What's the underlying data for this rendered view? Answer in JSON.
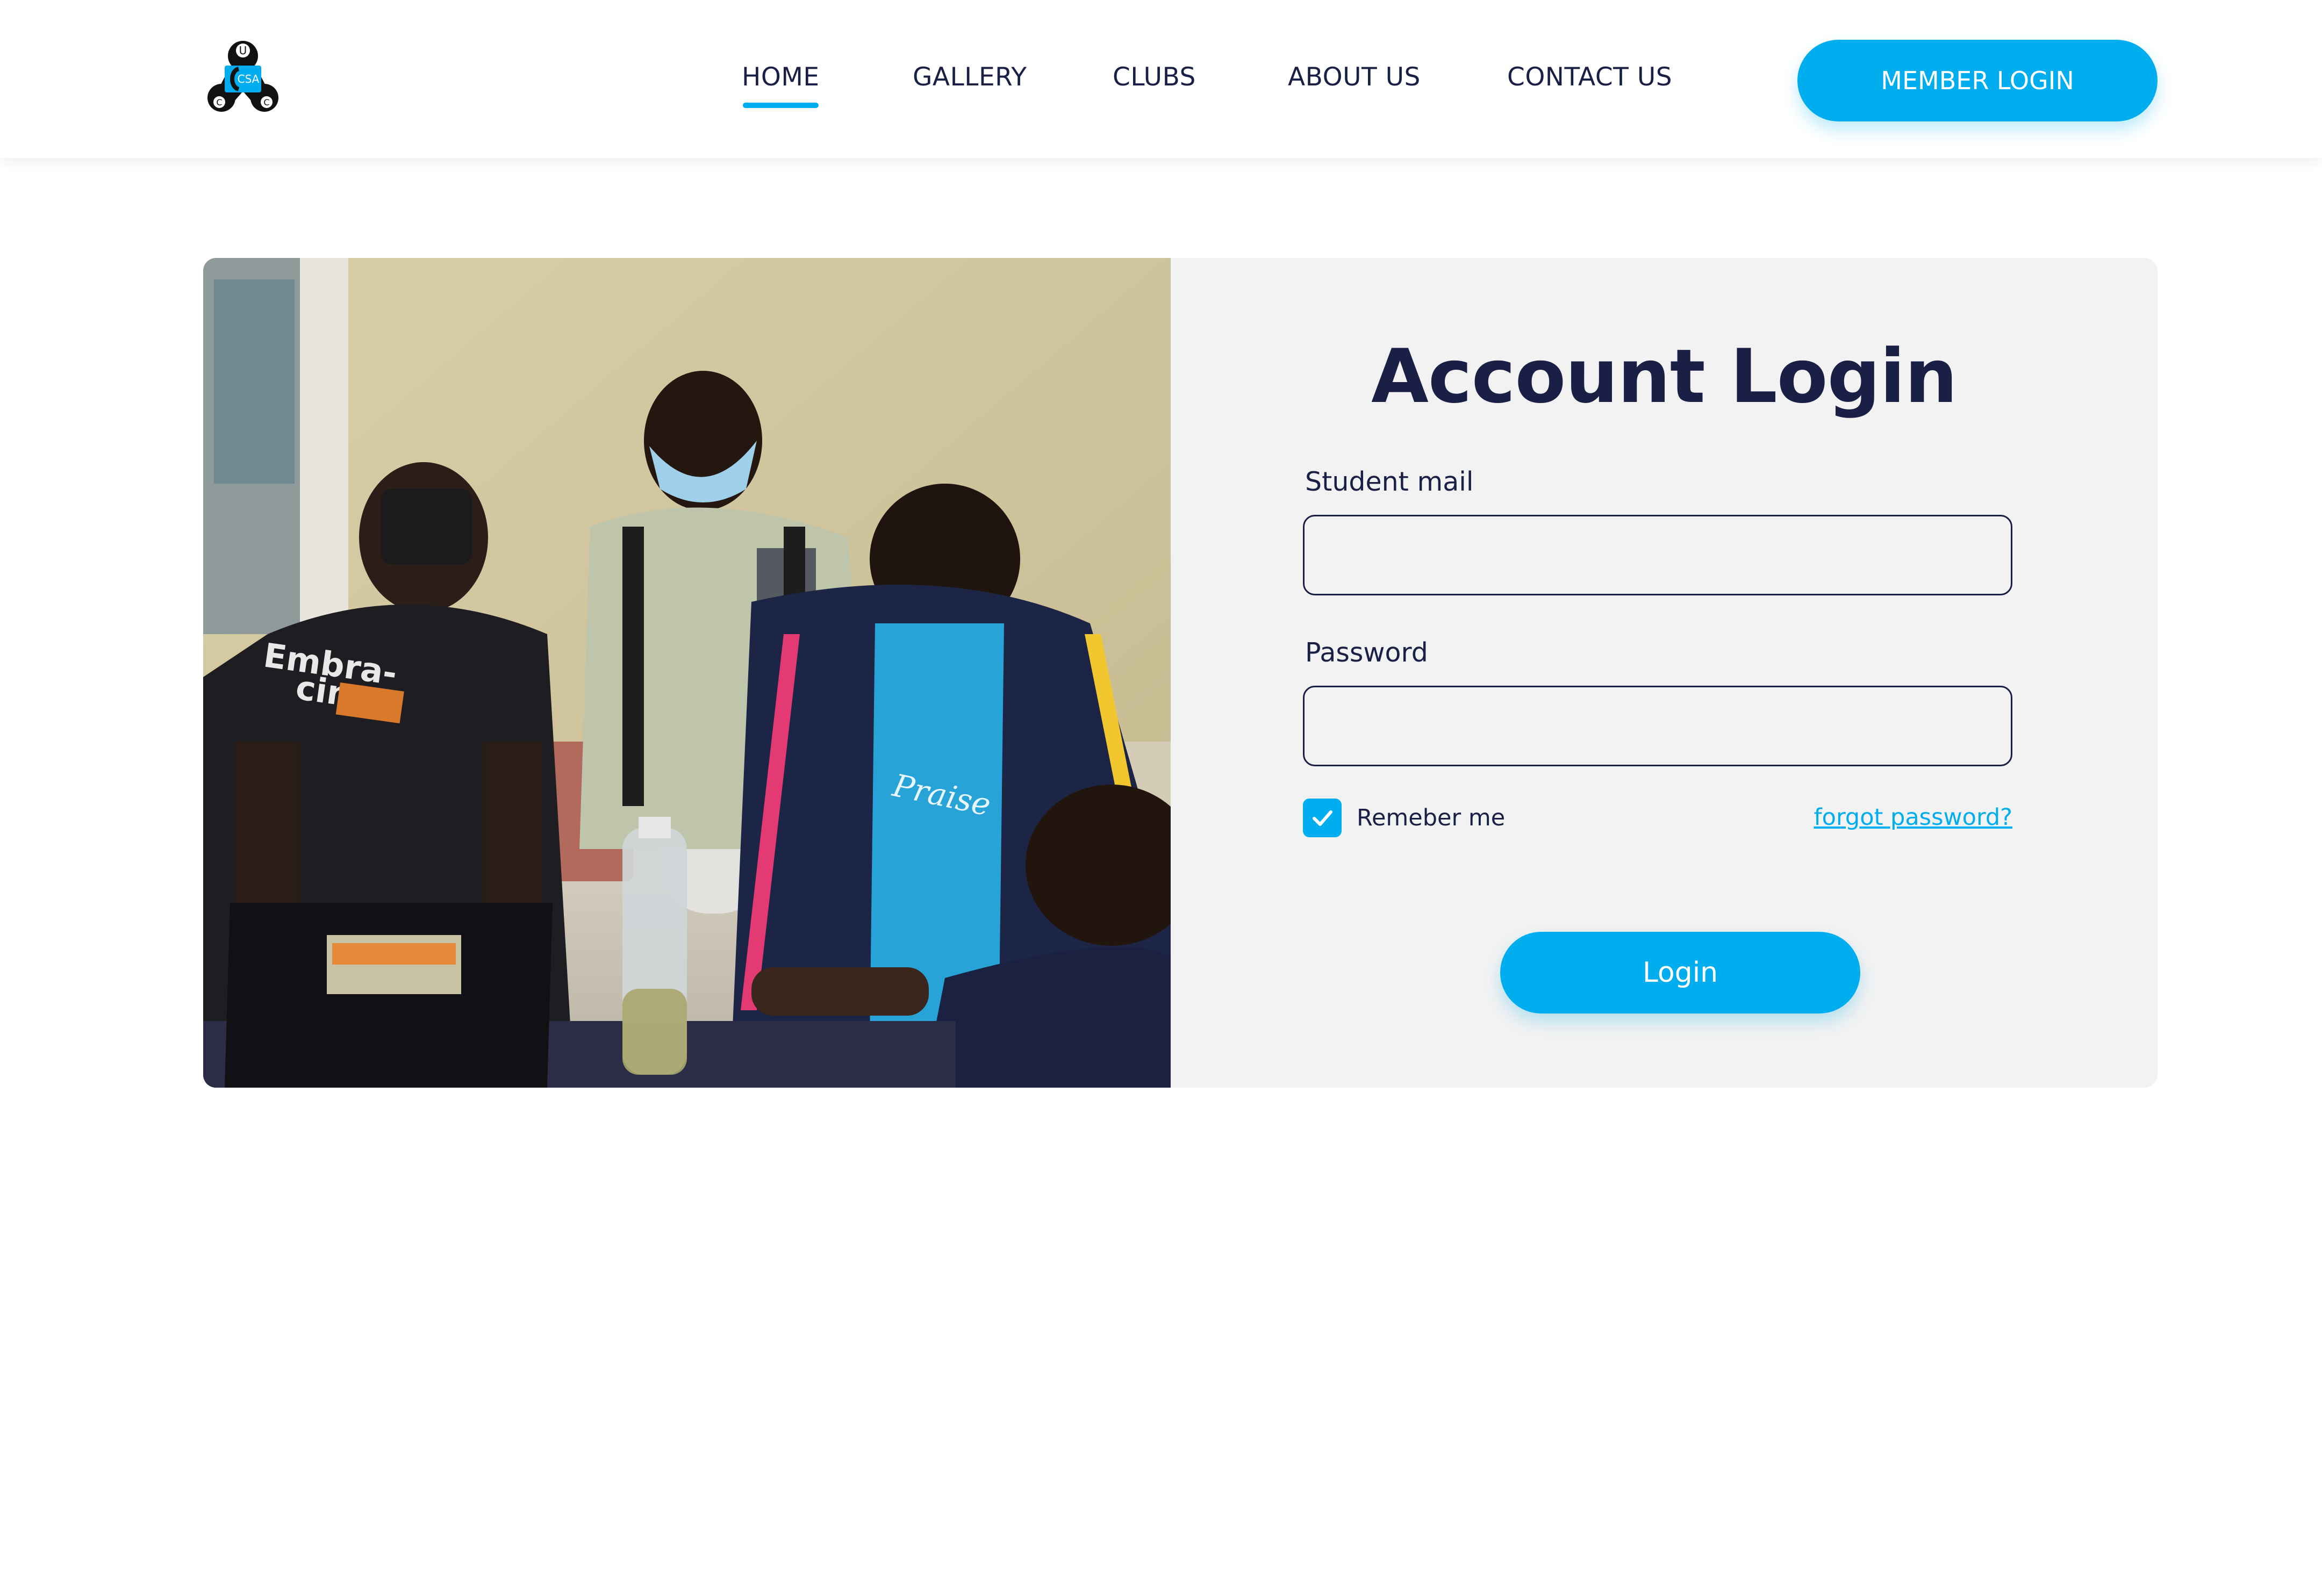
{
  "header": {
    "logo": {
      "icon": "ucc-cssa-logo",
      "letters": [
        "U",
        "C",
        "C",
        "CSA"
      ],
      "colors": {
        "black": "#111111",
        "blue": "#00aeef"
      }
    },
    "nav": [
      {
        "label": "HOME",
        "active": true
      },
      {
        "label": "GALLERY",
        "active": false
      },
      {
        "label": "CLUBS",
        "active": false
      },
      {
        "label": "ABOUT US",
        "active": false
      },
      {
        "label": "CONTACT US",
        "active": false
      }
    ],
    "member_login_label": "MEMBER LOGIN"
  },
  "photo": {
    "description_icon": "students-at-laptop-photo",
    "shirt_text_1": "Embra-",
    "shirt_text_2": "cing"
  },
  "login_form": {
    "title": "Account Login",
    "email": {
      "label": "Student mail",
      "value": "",
      "placeholder": ""
    },
    "password": {
      "label": "Password",
      "value": "",
      "placeholder": ""
    },
    "remember": {
      "label": "Remeber me",
      "checked": true
    },
    "forgot_label": "forgot password?",
    "submit_label": "Login"
  },
  "colors": {
    "accent": "#00aeef",
    "text_dark": "#1a1f45",
    "panel_bg": "#f2f2f2"
  }
}
